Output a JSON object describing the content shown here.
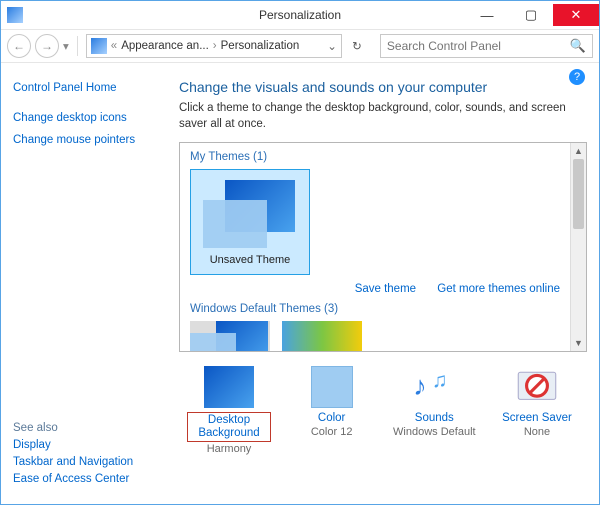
{
  "window": {
    "title": "Personalization"
  },
  "breadcrumb": {
    "part1": "Appearance an...",
    "part2": "Personalization",
    "sep": "«",
    "chev": "›"
  },
  "search": {
    "placeholder": "Search Control Panel"
  },
  "sidebar": {
    "home": "Control Panel Home",
    "links": [
      "Change desktop icons",
      "Change mouse pointers"
    ],
    "see_also_hdr": "See also",
    "see_also": [
      "Display",
      "Taskbar and Navigation",
      "Ease of Access Center"
    ]
  },
  "main": {
    "heading": "Change the visuals and sounds on your computer",
    "sub": "Click a theme to change the desktop background, color, sounds, and screen saver all at once.",
    "section_my": "My Themes (1)",
    "unsaved": "Unsaved Theme",
    "save_link": "Save theme",
    "online_link": "Get more themes online",
    "section_def": "Windows Default Themes (3)"
  },
  "options": {
    "bg": {
      "title": "Desktop Background",
      "value": "Harmony"
    },
    "color": {
      "title": "Color",
      "value": "Color 12"
    },
    "sounds": {
      "title": "Sounds",
      "value": "Windows Default"
    },
    "saver": {
      "title": "Screen Saver",
      "value": "None"
    }
  }
}
